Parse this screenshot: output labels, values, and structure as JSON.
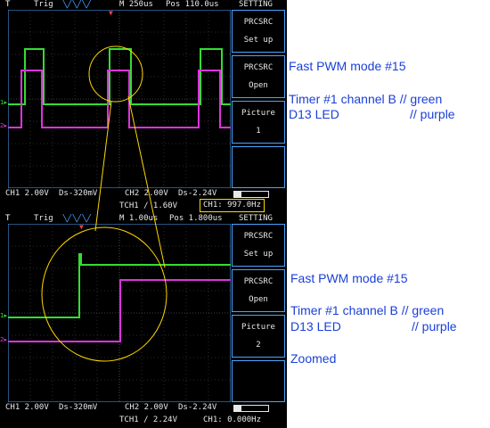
{
  "scope1": {
    "topbar": {
      "flag": "T",
      "trig": "Trig",
      "wave": "╲╱╲╱╲╱",
      "timebase": "M 250us",
      "pos": "Pos 110.0us",
      "setting": "SETTING"
    },
    "menu": [
      {
        "line1": "PRCSRC",
        "line2": "Set up"
      },
      {
        "line1": "PRCSRC",
        "line2": "Open"
      },
      {
        "line1": "Picture",
        "line2": "1"
      }
    ],
    "status": {
      "ch1": "CH1 2.00V",
      "ch1_ds": "Ds-320mV",
      "ch2": "CH2 2.00V",
      "ch2_ds": "Ds-2.24V",
      "tch": "TCH1 /  1.60V",
      "freq": "CH1:  997.0Hz"
    }
  },
  "scope2": {
    "topbar": {
      "flag": "T",
      "trig": "Trig",
      "wave": "╲╱╲╱╲╱",
      "timebase": "M 1.00us",
      "pos": "Pos 1.800us",
      "setting": "SETTING"
    },
    "menu": [
      {
        "line1": "PRCSRC",
        "line2": "Set up"
      },
      {
        "line1": "PRCSRC",
        "line2": "Open"
      },
      {
        "line1": "Picture",
        "line2": "2"
      }
    ],
    "status": {
      "ch1": "CH1 2.00V",
      "ch1_ds": "Ds-320mV",
      "ch2": "CH2 2.00V",
      "ch2_ds": "Ds-2.24V",
      "tch": "TCH1 /  2.24V",
      "freq": "CH1:  0.000Hz"
    }
  },
  "annotations1": {
    "mode": "Fast PWM mode #15",
    "line1": "Timer #1 channel B // green",
    "line2_a": "D13 LED",
    "line2_b": "// purple"
  },
  "annotations2": {
    "mode": "Fast PWM mode #15",
    "line1": "Timer #1 channel B // green",
    "line2_a": "D13 LED",
    "line2_b": "// purple",
    "zoom": "Zoomed"
  },
  "colors": {
    "ch1": "#33dd33",
    "ch2": "#dd33dd",
    "frame": "#4aa3ff",
    "annotation": "#1a3fd8",
    "highlight": "#ffd800"
  },
  "icons": {
    "trigger_marker": "trigger-arrow-icon",
    "ch_marker": "channel-level-icon"
  }
}
